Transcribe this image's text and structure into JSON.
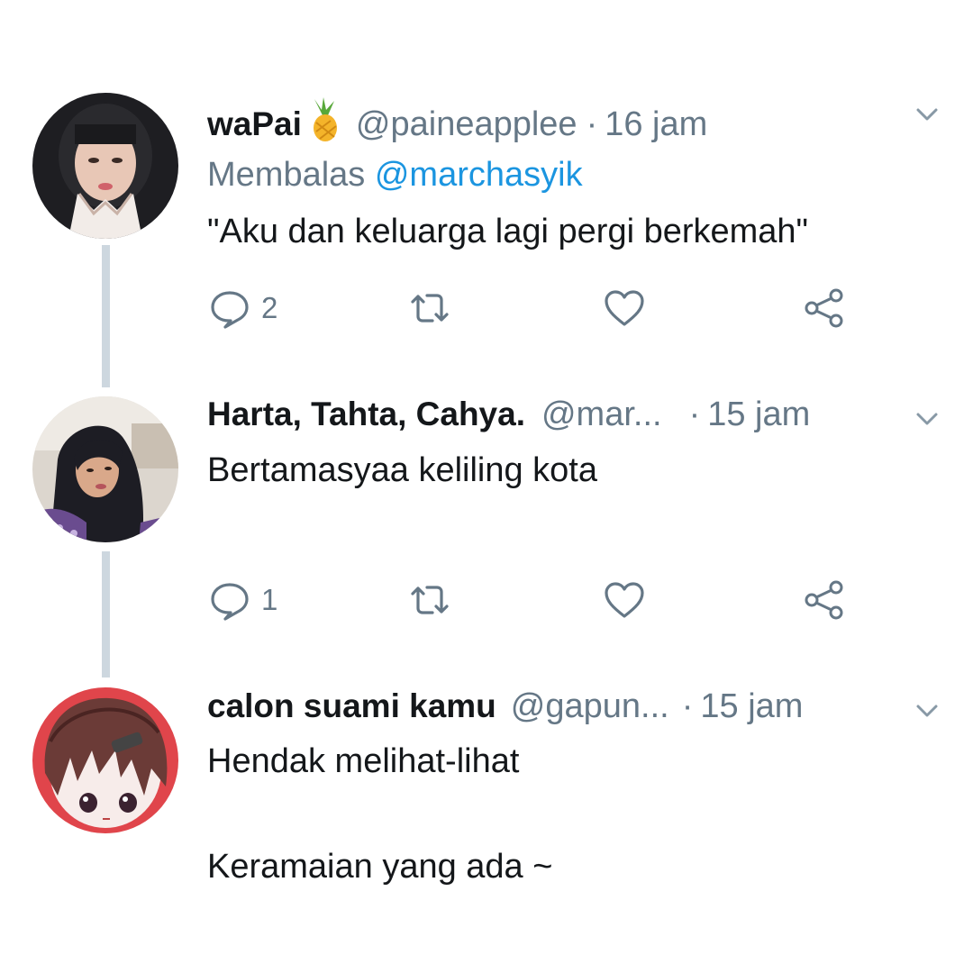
{
  "tweets": [
    {
      "display_name": "waPai",
      "emoji": "pineapple-emoji",
      "handle": "@paineapplee",
      "separator": "·",
      "time": "16 jam",
      "reply_prefix": "Membalas",
      "reply_mention": "@marchasyik",
      "text": "\"Aku dan keluarga lagi pergi berkemah\"",
      "reply_count": "2"
    },
    {
      "display_name": "Harta, Tahta, Cahya.",
      "handle": "@mar...",
      "separator": "·",
      "time": "15 jam",
      "text": "Bertamasyaa keliling kota",
      "reply_count": "1"
    },
    {
      "display_name": "calon suami kamu",
      "handle": "@gapun...",
      "separator": "·",
      "time": "15 jam",
      "text_line1": "Hendak melihat-lihat",
      "text_line2": "Keramaian yang ada ~"
    }
  ],
  "colors": {
    "primary_text": "#14171a",
    "secondary_text": "#657786",
    "link": "#1b95e0",
    "thread_line": "#cdd7df"
  },
  "icons": [
    "chevron-down-icon",
    "reply-icon",
    "retweet-icon",
    "heart-icon",
    "share-icon"
  ]
}
